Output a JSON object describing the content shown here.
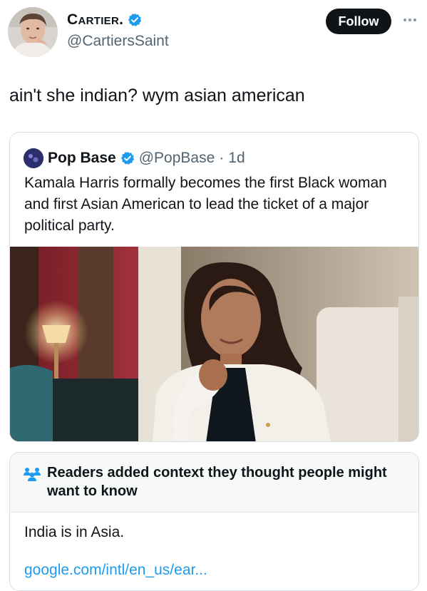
{
  "author": {
    "display_name": "Cartier.",
    "handle": "@CartiersSaint",
    "verified": true,
    "follow_label": "Follow"
  },
  "tweet": {
    "text": "ain't she indian? wym asian american"
  },
  "quote": {
    "name": "Pop Base",
    "handle": "@PopBase",
    "separator": "·",
    "time": "1d",
    "text": "Kamala Harris formally becomes the first Black woman and first Asian American to lead the ticket of a major political party.",
    "image_alt": "portrait photo of a woman in a white blazer seated in a lounge"
  },
  "community_note": {
    "title": "Readers added context they thought people might want to know",
    "body": "India is in Asia.",
    "link": "google.com/intl/en_us/ear..."
  },
  "colors": {
    "verified_blue": "#1d9bf0",
    "follow_bg": "#0f1419",
    "link_blue": "#1d9bf0",
    "secondary_text": "#536471"
  }
}
